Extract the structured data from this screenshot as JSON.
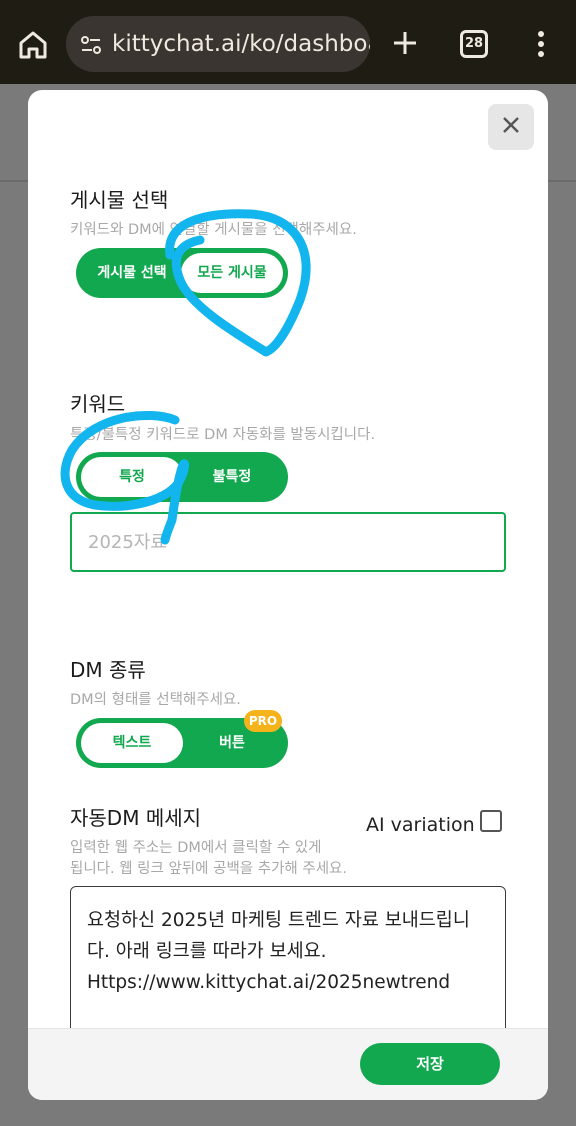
{
  "browser": {
    "url": "kittychat.ai/ko/dashboard",
    "tab_count": "28"
  },
  "modal": {
    "post_section": {
      "title": "게시물 선택",
      "subtitle": "키워드와 DM에 연결할 게시물을 선택해주세요.",
      "options": [
        "게시물 선택",
        "모든 게시물"
      ],
      "selected": "모든 게시물"
    },
    "keyword_section": {
      "title": "키워드",
      "subtitle": "특정/불특정 키워드로 DM 자동화를 발동시킵니다.",
      "options": [
        "특정",
        "불특정"
      ],
      "selected": "특정",
      "input_placeholder": "2025자료"
    },
    "dm_type_section": {
      "title": "DM 종류",
      "subtitle": "DM의 형태를 선택해주세요.",
      "options": [
        "텍스트",
        "버튼"
      ],
      "selected": "텍스트",
      "pro_badge": "PRO"
    },
    "auto_dm_section": {
      "title": "자동DM 메세지",
      "subtitle_line1": "입력한 웹 주소는 DM에서 클릭할 수 있게",
      "subtitle_line2": "됩니다. 웹 링크 앞뒤에 공백을 추가해 주세요.",
      "ai_variation_label": "AI variation",
      "ai_variation_checked": false,
      "message": "요청하신 2025년 마케팅 트렌드 자료 보내드립니다. 아래 링크를 따라가 보세요.\nHttps://www.kittychat.ai/2025newtrend"
    },
    "save_label": "저장"
  },
  "colors": {
    "brand_green": "#12a84f",
    "annotation_blue": "#12b5ee",
    "pro_badge": "#f4b21b"
  }
}
